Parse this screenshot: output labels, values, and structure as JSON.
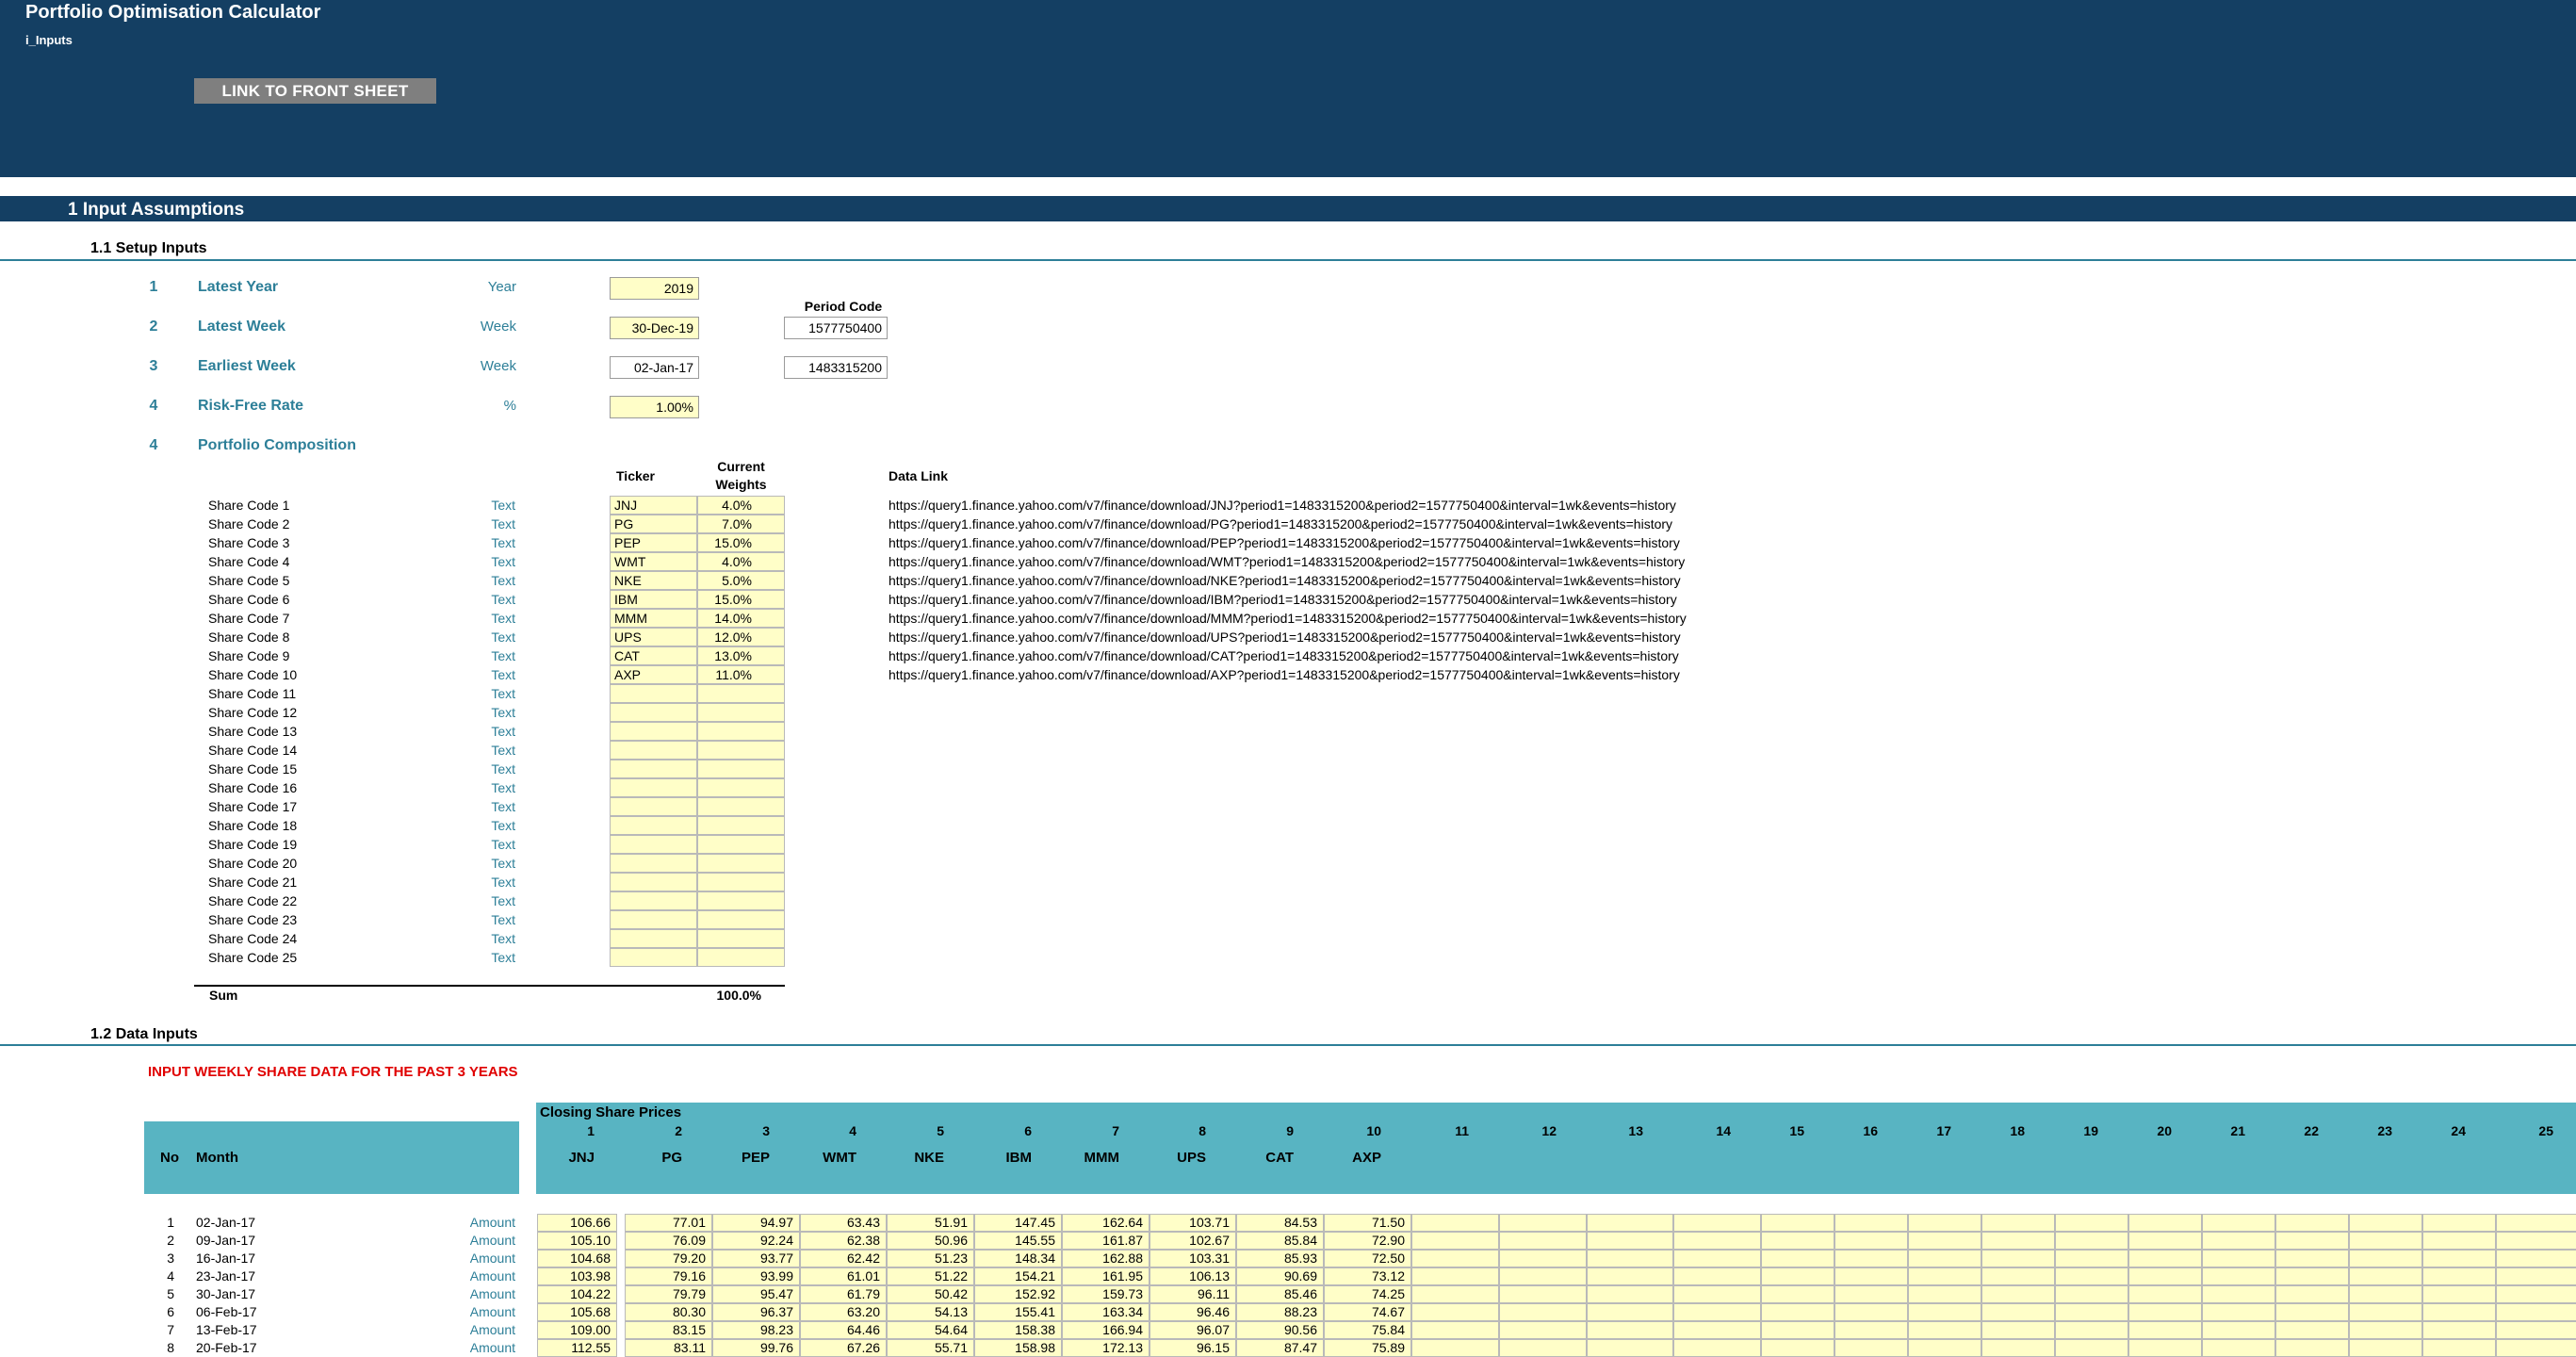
{
  "header": {
    "app_title": "Portfolio Optimisation Calculator",
    "sheet_name": "i_Inputs",
    "link_button": "LINK TO FRONT SHEET"
  },
  "section": {
    "title": "1  Input Assumptions",
    "setup_header": "1.1  Setup Inputs",
    "data_header": "1.2  Data Inputs"
  },
  "setup": {
    "period_code_header": "Period Code",
    "rows": [
      {
        "num": "1",
        "label": "Latest Year",
        "unit": "Year",
        "value": "2019",
        "code": ""
      },
      {
        "num": "2",
        "label": "Latest Week",
        "unit": "Week",
        "value": "30-Dec-19",
        "code": "1577750400"
      },
      {
        "num": "3",
        "label": "Earliest Week",
        "unit": "Week",
        "value": "02-Jan-17",
        "code": "1483315200"
      },
      {
        "num": "4",
        "label": "Risk-Free Rate",
        "unit": "%",
        "value": "1.00%",
        "code": ""
      }
    ],
    "composition": {
      "num": "4",
      "label": "Portfolio Composition"
    }
  },
  "composition": {
    "ticker_header": "Ticker",
    "weights_header_1": "Current",
    "weights_header_2": "Weights",
    "data_link_header": "Data Link",
    "unit": "Text",
    "sum_label": "Sum",
    "sum_value": "100.0%",
    "shares": [
      {
        "label": "Share Code 1",
        "ticker": "JNJ",
        "weight": "4.0%",
        "link": "https://query1.finance.yahoo.com/v7/finance/download/JNJ?period1=1483315200&period2=1577750400&interval=1wk&events=history"
      },
      {
        "label": "Share Code 2",
        "ticker": "PG",
        "weight": "7.0%",
        "link": "https://query1.finance.yahoo.com/v7/finance/download/PG?period1=1483315200&period2=1577750400&interval=1wk&events=history"
      },
      {
        "label": "Share Code 3",
        "ticker": "PEP",
        "weight": "15.0%",
        "link": "https://query1.finance.yahoo.com/v7/finance/download/PEP?period1=1483315200&period2=1577750400&interval=1wk&events=history"
      },
      {
        "label": "Share Code 4",
        "ticker": "WMT",
        "weight": "4.0%",
        "link": "https://query1.finance.yahoo.com/v7/finance/download/WMT?period1=1483315200&period2=1577750400&interval=1wk&events=history"
      },
      {
        "label": "Share Code 5",
        "ticker": "NKE",
        "weight": "5.0%",
        "link": "https://query1.finance.yahoo.com/v7/finance/download/NKE?period1=1483315200&period2=1577750400&interval=1wk&events=history"
      },
      {
        "label": "Share Code 6",
        "ticker": "IBM",
        "weight": "15.0%",
        "link": "https://query1.finance.yahoo.com/v7/finance/download/IBM?period1=1483315200&period2=1577750400&interval=1wk&events=history"
      },
      {
        "label": "Share Code 7",
        "ticker": "MMM",
        "weight": "14.0%",
        "link": "https://query1.finance.yahoo.com/v7/finance/download/MMM?period1=1483315200&period2=1577750400&interval=1wk&events=history"
      },
      {
        "label": "Share Code 8",
        "ticker": "UPS",
        "weight": "12.0%",
        "link": "https://query1.finance.yahoo.com/v7/finance/download/UPS?period1=1483315200&period2=1577750400&interval=1wk&events=history"
      },
      {
        "label": "Share Code 9",
        "ticker": "CAT",
        "weight": "13.0%",
        "link": "https://query1.finance.yahoo.com/v7/finance/download/CAT?period1=1483315200&period2=1577750400&interval=1wk&events=history"
      },
      {
        "label": "Share Code 10",
        "ticker": "AXP",
        "weight": "11.0%",
        "link": "https://query1.finance.yahoo.com/v7/finance/download/AXP?period1=1483315200&period2=1577750400&interval=1wk&events=history"
      },
      {
        "label": "Share Code 11",
        "ticker": "",
        "weight": "",
        "link": ""
      },
      {
        "label": "Share Code 12",
        "ticker": "",
        "weight": "",
        "link": ""
      },
      {
        "label": "Share Code 13",
        "ticker": "",
        "weight": "",
        "link": ""
      },
      {
        "label": "Share Code 14",
        "ticker": "",
        "weight": "",
        "link": ""
      },
      {
        "label": "Share Code 15",
        "ticker": "",
        "weight": "",
        "link": ""
      },
      {
        "label": "Share Code 16",
        "ticker": "",
        "weight": "",
        "link": ""
      },
      {
        "label": "Share Code 17",
        "ticker": "",
        "weight": "",
        "link": ""
      },
      {
        "label": "Share Code 18",
        "ticker": "",
        "weight": "",
        "link": ""
      },
      {
        "label": "Share Code 19",
        "ticker": "",
        "weight": "",
        "link": ""
      },
      {
        "label": "Share Code 20",
        "ticker": "",
        "weight": "",
        "link": ""
      },
      {
        "label": "Share Code 21",
        "ticker": "",
        "weight": "",
        "link": ""
      },
      {
        "label": "Share Code 22",
        "ticker": "",
        "weight": "",
        "link": ""
      },
      {
        "label": "Share Code 23",
        "ticker": "",
        "weight": "",
        "link": ""
      },
      {
        "label": "Share Code 24",
        "ticker": "",
        "weight": "",
        "link": ""
      },
      {
        "label": "Share Code 25",
        "ticker": "",
        "weight": "",
        "link": ""
      }
    ]
  },
  "data_inputs": {
    "note": "INPUT WEEKLY SHARE DATA FOR THE PAST 3 YEARS",
    "closing_header": "Closing Share Prices",
    "no_header": "No",
    "month_header": "Month",
    "row_unit": "Amount",
    "column_numbers": [
      "1",
      "2",
      "3",
      "4",
      "5",
      "6",
      "7",
      "8",
      "9",
      "10",
      "11",
      "12",
      "13",
      "14",
      "15",
      "16",
      "17",
      "18",
      "19",
      "20",
      "21",
      "22",
      "23",
      "24",
      "25"
    ],
    "column_names": [
      "JNJ",
      "PG",
      "PEP",
      "WMT",
      "NKE",
      "IBM",
      "MMM",
      "UPS",
      "CAT",
      "AXP",
      "",
      "",
      "",
      "",
      "",
      "",
      "",
      "",
      "",
      "",
      "",
      "",
      "",
      "",
      ""
    ],
    "rows": [
      {
        "no": "1",
        "date": "02-Jan-17",
        "prices": [
          "106.66",
          "77.01",
          "94.97",
          "63.43",
          "51.91",
          "147.45",
          "162.64",
          "103.71",
          "84.53",
          "71.50"
        ]
      },
      {
        "no": "2",
        "date": "09-Jan-17",
        "prices": [
          "105.10",
          "76.09",
          "92.24",
          "62.38",
          "50.96",
          "145.55",
          "161.87",
          "102.67",
          "85.84",
          "72.90"
        ]
      },
      {
        "no": "3",
        "date": "16-Jan-17",
        "prices": [
          "104.68",
          "79.20",
          "93.77",
          "62.42",
          "51.23",
          "148.34",
          "162.88",
          "103.31",
          "85.93",
          "72.50"
        ]
      },
      {
        "no": "4",
        "date": "23-Jan-17",
        "prices": [
          "103.98",
          "79.16",
          "93.99",
          "61.01",
          "51.22",
          "154.21",
          "161.95",
          "106.13",
          "90.69",
          "73.12"
        ]
      },
      {
        "no": "5",
        "date": "30-Jan-17",
        "prices": [
          "104.22",
          "79.79",
          "95.47",
          "61.79",
          "50.42",
          "152.92",
          "159.73",
          "96.11",
          "85.46",
          "74.25"
        ]
      },
      {
        "no": "6",
        "date": "06-Feb-17",
        "prices": [
          "105.68",
          "80.30",
          "96.37",
          "63.20",
          "54.13",
          "155.41",
          "163.34",
          "96.46",
          "88.23",
          "74.67"
        ]
      },
      {
        "no": "7",
        "date": "13-Feb-17",
        "prices": [
          "109.00",
          "83.15",
          "98.23",
          "64.46",
          "54.64",
          "158.38",
          "166.94",
          "96.07",
          "90.56",
          "75.84"
        ]
      },
      {
        "no": "8",
        "date": "20-Feb-17",
        "prices": [
          "112.55",
          "83.11",
          "99.76",
          "67.26",
          "55.71",
          "158.98",
          "172.13",
          "96.15",
          "87.47",
          "75.89"
        ]
      }
    ]
  }
}
